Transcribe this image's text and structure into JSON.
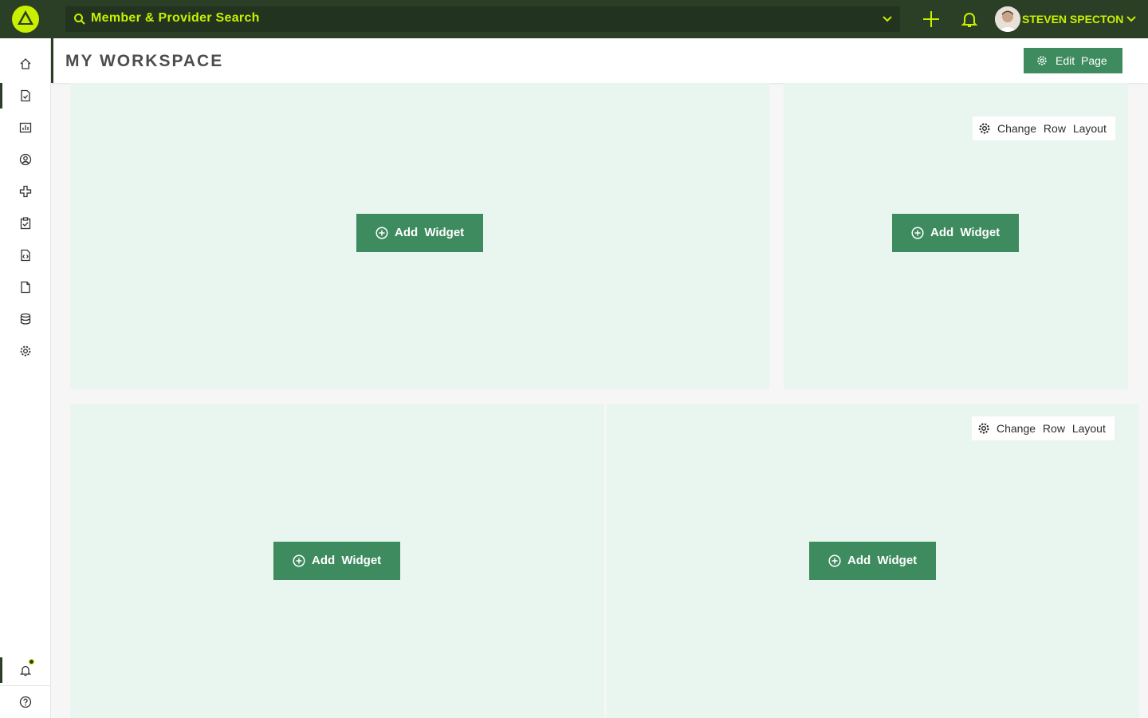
{
  "topbar": {
    "search_label": "Member & Provider Search",
    "username": "STEVEN SPECTON",
    "icons": [
      "logo-icon",
      "search-icon",
      "chevron-down-icon",
      "plus-icon",
      "bell-icon",
      "avatar",
      "chevron-down-icon"
    ]
  },
  "sidebar": {
    "items": [
      "home-icon",
      "document-check-icon",
      "chart-icon",
      "user-circle-icon",
      "plus-cross-icon",
      "clipboard-check-icon",
      "document-code-icon",
      "file-icon",
      "database-icon",
      "settings-icon"
    ],
    "bottom": [
      "notifications-icon",
      "help-icon"
    ]
  },
  "header": {
    "title": "MY WORKSPACE",
    "edit_label": "Edit Page"
  },
  "workspace": {
    "add_widget_label": "Add Widget",
    "change_layout_label": "Change Row Layout"
  },
  "colors": {
    "topbar": "#2b3f26",
    "accent": "#c8f000",
    "button": "#3d8b5e",
    "panel": "#e9f6ef"
  }
}
